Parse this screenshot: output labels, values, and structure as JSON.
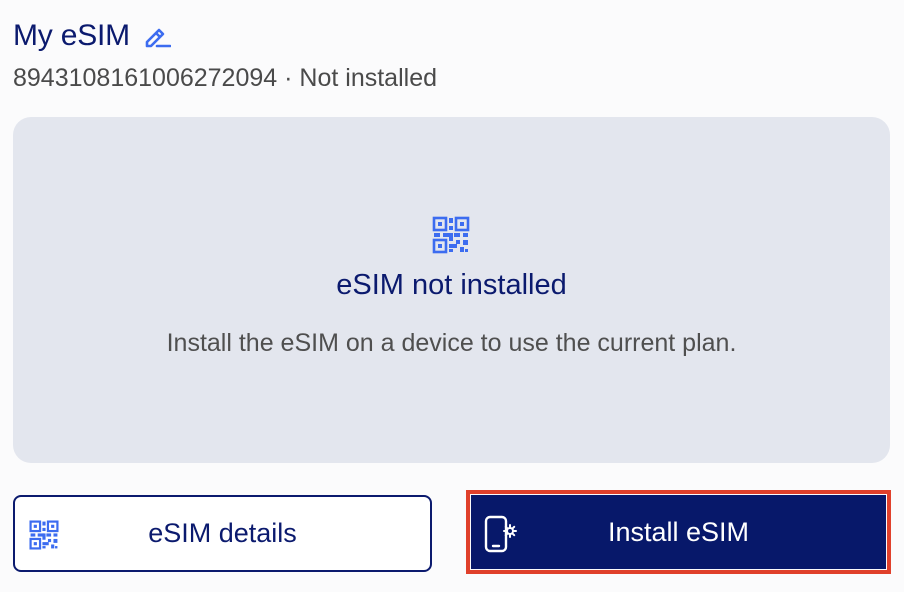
{
  "header": {
    "title": "My eSIM",
    "edit_icon": "pencil-edit-icon",
    "iccid": "8943108161006272094",
    "separator": "·",
    "status": "Not installed"
  },
  "panel": {
    "icon": "qr-code-icon",
    "title": "eSIM not installed",
    "description": "Install the eSIM on a device to use the current plan."
  },
  "actions": {
    "details_label": "eSIM details",
    "details_icon": "qr-code-icon",
    "install_label": "Install eSIM",
    "install_icon": "phone-settings-icon"
  },
  "colors": {
    "brand_navy": "#07186a",
    "accent_blue": "#3c6cf0",
    "panel_bg": "#e3e6ee",
    "highlight_outline": "#e0402b"
  }
}
